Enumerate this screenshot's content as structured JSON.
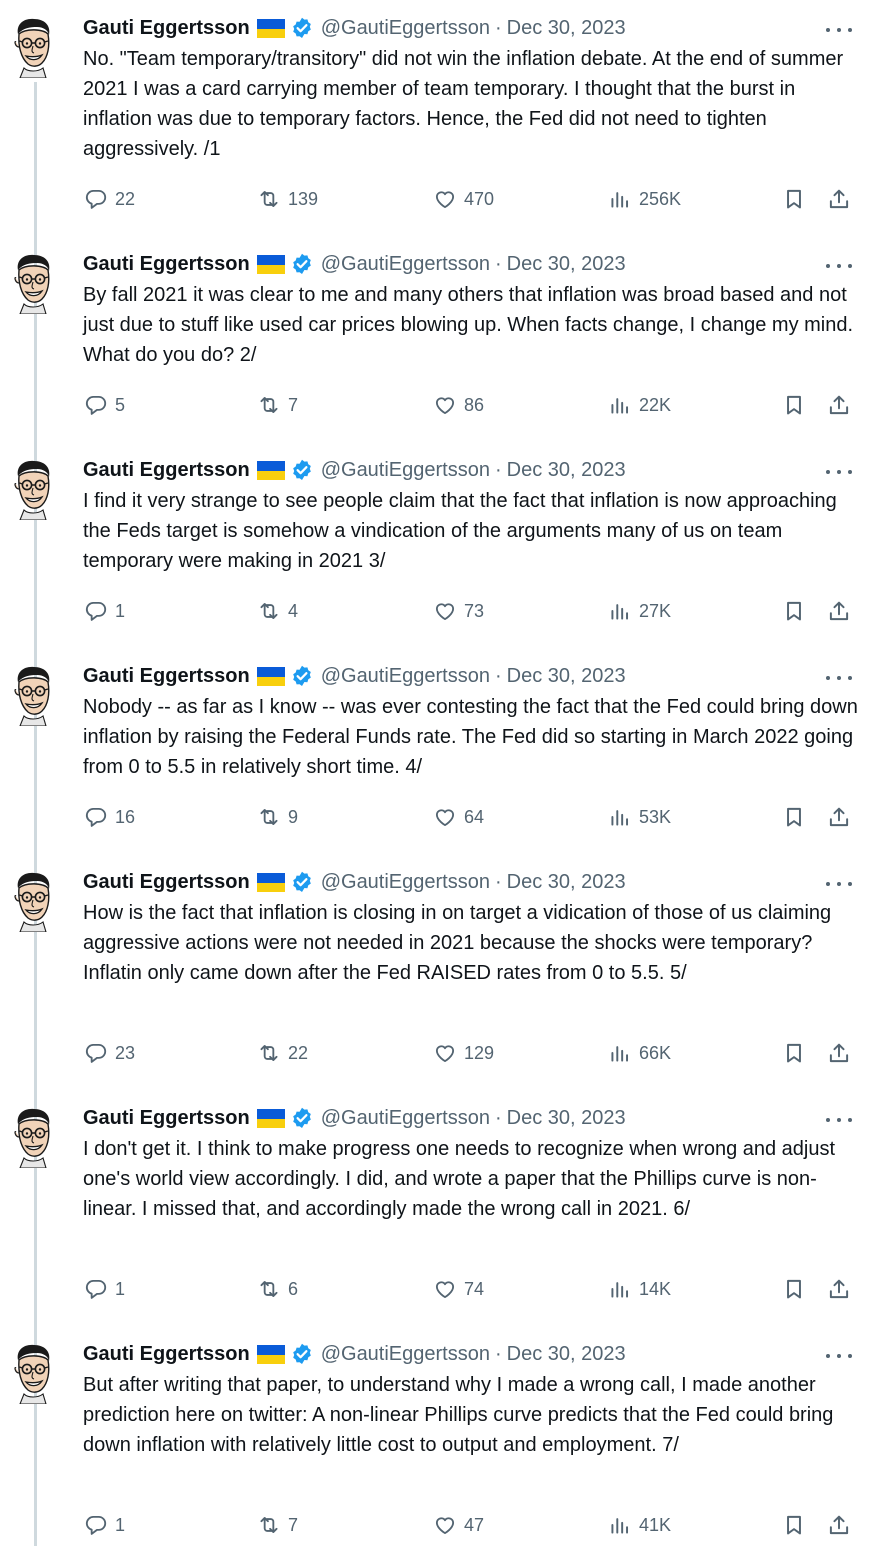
{
  "author": {
    "name": "Gauti Eggertsson",
    "handle": "@GautiEggertsson",
    "date": "Dec 30, 2023",
    "separator": "·",
    "flag": "ukraine-flag",
    "badge": "verified-icon"
  },
  "tweets": [
    {
      "text": "No. \"Team temporary/transitory\" did not win the inflation debate. At the end of summer 2021 I was a card carrying member of team temporary. I thought that the burst in inflation was due to temporary factors. Hence, the Fed did not need to tighten aggressively. /1",
      "replies": "22",
      "retweets": "139",
      "likes": "470",
      "views": "256K"
    },
    {
      "text": "By fall 2021 it was clear to me and many others that inflation was broad based and not just due to stuff like used car prices blowing up. When facts change, I change my mind. What do you do? 2/",
      "replies": "5",
      "retweets": "7",
      "likes": "86",
      "views": "22K"
    },
    {
      "text": "I find it very strange to see people claim that the fact that inflation is now approaching the Feds target is somehow a vindication of the arguments many of us on team temporary were making in 2021 3/",
      "replies": "1",
      "retweets": "4",
      "likes": "73",
      "views": "27K"
    },
    {
      "text": "Nobody -- as far as I know -- was ever contesting the fact that the Fed could bring down inflation by raising the Federal Funds rate. The Fed did so starting in March 2022 going from 0 to 5.5 in relatively short time. 4/",
      "replies": "16",
      "retweets": "9",
      "likes": "64",
      "views": "53K"
    },
    {
      "text": "How is the fact that inflation is closing in on target a vidication of those of us claiming aggressive actions were not needed in 2021 because the shocks were temporary? Inflatin only came down after the Fed RAISED rates from 0 to 5.5. 5/",
      "replies": "23",
      "retweets": "22",
      "likes": "129",
      "views": "66K"
    },
    {
      "text": "I don't get it. I think to make progress one needs to recognize when wrong and adjust one's world view accordingly. I did, and wrote a paper that the Phillips curve is non-linear. I missed that, and accordingly made the wrong call in 2021. 6/",
      "replies": "1",
      "retweets": "6",
      "likes": "74",
      "views": "14K"
    },
    {
      "text": "But after writing that paper, to understand why I made a wrong call, I made another prediction here on twitter: A non-linear Phillips curve predicts that the Fed could bring down inflation with relatively little cost to output and employment. 7/",
      "replies": "1",
      "retweets": "7",
      "likes": "47",
      "views": "41K"
    }
  ],
  "icons": {
    "reply": "reply-icon",
    "retweet": "retweet-icon",
    "like": "heart-icon",
    "views": "views-icon",
    "bookmark": "bookmark-icon",
    "share": "share-icon",
    "more": "more-icon"
  },
  "colors": {
    "text": "#0f1419",
    "secondary": "#536471",
    "thread_line": "#cfd9de",
    "verified": "#1d9bf0",
    "flag_blue": "#0a5bd8",
    "flag_yellow": "#f8cf0d"
  }
}
